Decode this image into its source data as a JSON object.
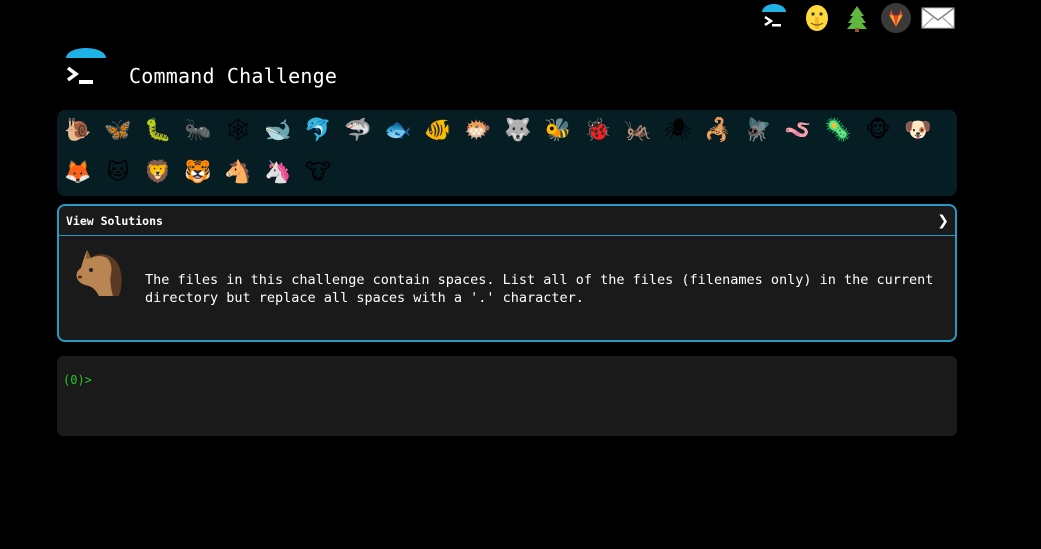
{
  "header": {
    "title": "Command Challenge",
    "icons": [
      "terminal-umbrella-icon",
      "shush-face-icon",
      "tree-icon",
      "gitlab-icon",
      "mail-icon"
    ]
  },
  "animals": [
    {
      "name": "snail",
      "glyph": "🐌"
    },
    {
      "name": "butterfly",
      "glyph": "🦋"
    },
    {
      "name": "caterpillar",
      "glyph": "🐛"
    },
    {
      "name": "ant",
      "glyph": "🐜"
    },
    {
      "name": "spiderweb",
      "glyph": "🕸"
    },
    {
      "name": "whale",
      "glyph": "🐋"
    },
    {
      "name": "dolphin",
      "glyph": "🐬"
    },
    {
      "name": "shark",
      "glyph": "🦈"
    },
    {
      "name": "fish",
      "glyph": "🐟"
    },
    {
      "name": "tropical-fish",
      "glyph": "🐠"
    },
    {
      "name": "blowfish",
      "glyph": "🐡"
    },
    {
      "name": "wolf",
      "glyph": "🐺"
    },
    {
      "name": "bee",
      "glyph": "🐝"
    },
    {
      "name": "ladybug",
      "glyph": "🐞"
    },
    {
      "name": "cricket",
      "glyph": "🦗"
    },
    {
      "name": "spider",
      "glyph": "🕷"
    },
    {
      "name": "scorpion",
      "glyph": "🦂"
    },
    {
      "name": "fly",
      "glyph": "🪰"
    },
    {
      "name": "worm",
      "glyph": "🪱"
    },
    {
      "name": "microbe",
      "glyph": "🦠"
    },
    {
      "name": "monkey",
      "glyph": "🐵"
    },
    {
      "name": "dog",
      "glyph": "🐶"
    },
    {
      "name": "fox",
      "glyph": "🦊"
    },
    {
      "name": "cat",
      "glyph": "🐱"
    },
    {
      "name": "lion",
      "glyph": "🦁"
    },
    {
      "name": "tiger",
      "glyph": "🐯"
    },
    {
      "name": "horse",
      "glyph": "🐴"
    },
    {
      "name": "unicorn",
      "glyph": "🦄"
    },
    {
      "name": "cow",
      "glyph": "🐮"
    }
  ],
  "panel": {
    "header_label": "View Solutions",
    "chevron": "❯",
    "challenge_text": "The files in this challenge contain spaces. List all of the files (filenames only) in the current directory but replace all spaces with a '.' character.",
    "icon": "horse-head-icon"
  },
  "terminal": {
    "prompt": "(0)>"
  },
  "colors": {
    "background": "#000000",
    "animal_bar": "#061d24",
    "panel_border": "#2a98c4",
    "panel_bg": "#1a1a1a",
    "prompt": "#2bc52b",
    "accent_blue": "#1fb2e6"
  }
}
